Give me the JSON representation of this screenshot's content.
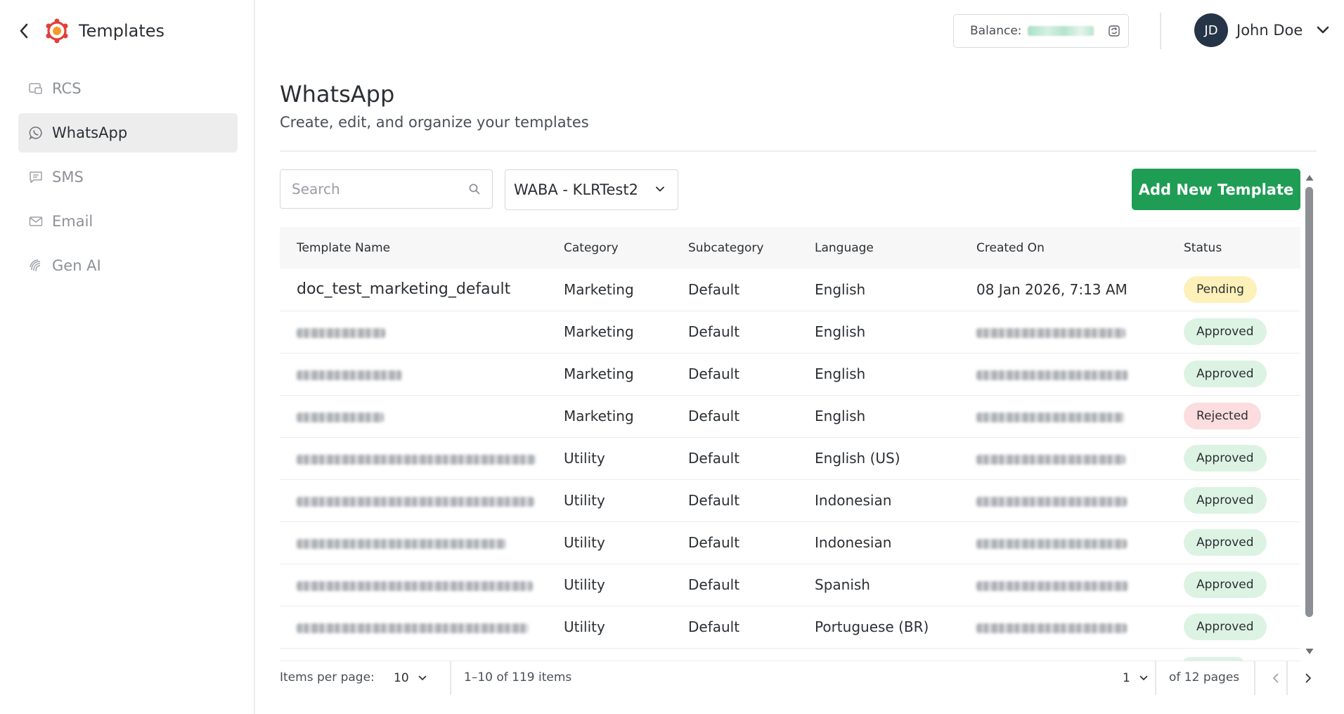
{
  "app": {
    "title": "Templates"
  },
  "sidebar": {
    "items": [
      {
        "label": "RCS",
        "icon": "rcs-icon",
        "active": false
      },
      {
        "label": "WhatsApp",
        "icon": "whatsapp-icon",
        "active": true
      },
      {
        "label": "SMS",
        "icon": "sms-icon",
        "active": false
      },
      {
        "label": "Email",
        "icon": "email-icon",
        "active": false
      },
      {
        "label": "Gen AI",
        "icon": "gen-ai-icon",
        "active": false
      }
    ]
  },
  "header": {
    "balance_label": "Balance:",
    "user": {
      "initials": "JD",
      "name": "John Doe"
    }
  },
  "main": {
    "title": "WhatsApp",
    "subtitle": "Create, edit, and organize your templates",
    "search_placeholder": "Search",
    "waba_selected": "WABA - KLRTest2",
    "add_button": "Add New Template"
  },
  "table": {
    "columns": [
      "Template Name",
      "Category",
      "Subcategory",
      "Language",
      "Created On",
      "Status"
    ],
    "rows": [
      {
        "name": "doc_test_marketing_default",
        "category": "Marketing",
        "subcategory": "Default",
        "language": "English",
        "created": "08 Jan 2026, 7:13 AM",
        "status": "Pending"
      },
      {
        "name": "",
        "category": "Marketing",
        "subcategory": "Default",
        "language": "English",
        "created": "",
        "status": "Approved"
      },
      {
        "name": "",
        "category": "Marketing",
        "subcategory": "Default",
        "language": "English",
        "created": "",
        "status": "Approved"
      },
      {
        "name": "",
        "category": "Marketing",
        "subcategory": "Default",
        "language": "English",
        "created": "",
        "status": "Rejected"
      },
      {
        "name": "",
        "category": "Utility",
        "subcategory": "Default",
        "language": "English (US)",
        "created": "",
        "status": "Approved"
      },
      {
        "name": "",
        "category": "Utility",
        "subcategory": "Default",
        "language": "Indonesian",
        "created": "",
        "status": "Approved"
      },
      {
        "name": "",
        "category": "Utility",
        "subcategory": "Default",
        "language": "Indonesian",
        "created": "",
        "status": "Approved"
      },
      {
        "name": "",
        "category": "Utility",
        "subcategory": "Default",
        "language": "Spanish",
        "created": "",
        "status": "Approved"
      },
      {
        "name": "",
        "category": "Utility",
        "subcategory": "Default",
        "language": "Portuguese (BR)",
        "created": "",
        "status": "Approved"
      }
    ]
  },
  "pagination": {
    "items_per_page_label": "Items per page:",
    "items_per_page": "10",
    "range": "1–10 of 119 items",
    "current_page": "1",
    "of_pages": "of 12 pages"
  },
  "colors": {
    "primary_green": "#1f9d55",
    "pending": "#fdf0b8",
    "approved": "#dcf3e3",
    "rejected": "#fbdcdf",
    "avatar": "#263447"
  }
}
